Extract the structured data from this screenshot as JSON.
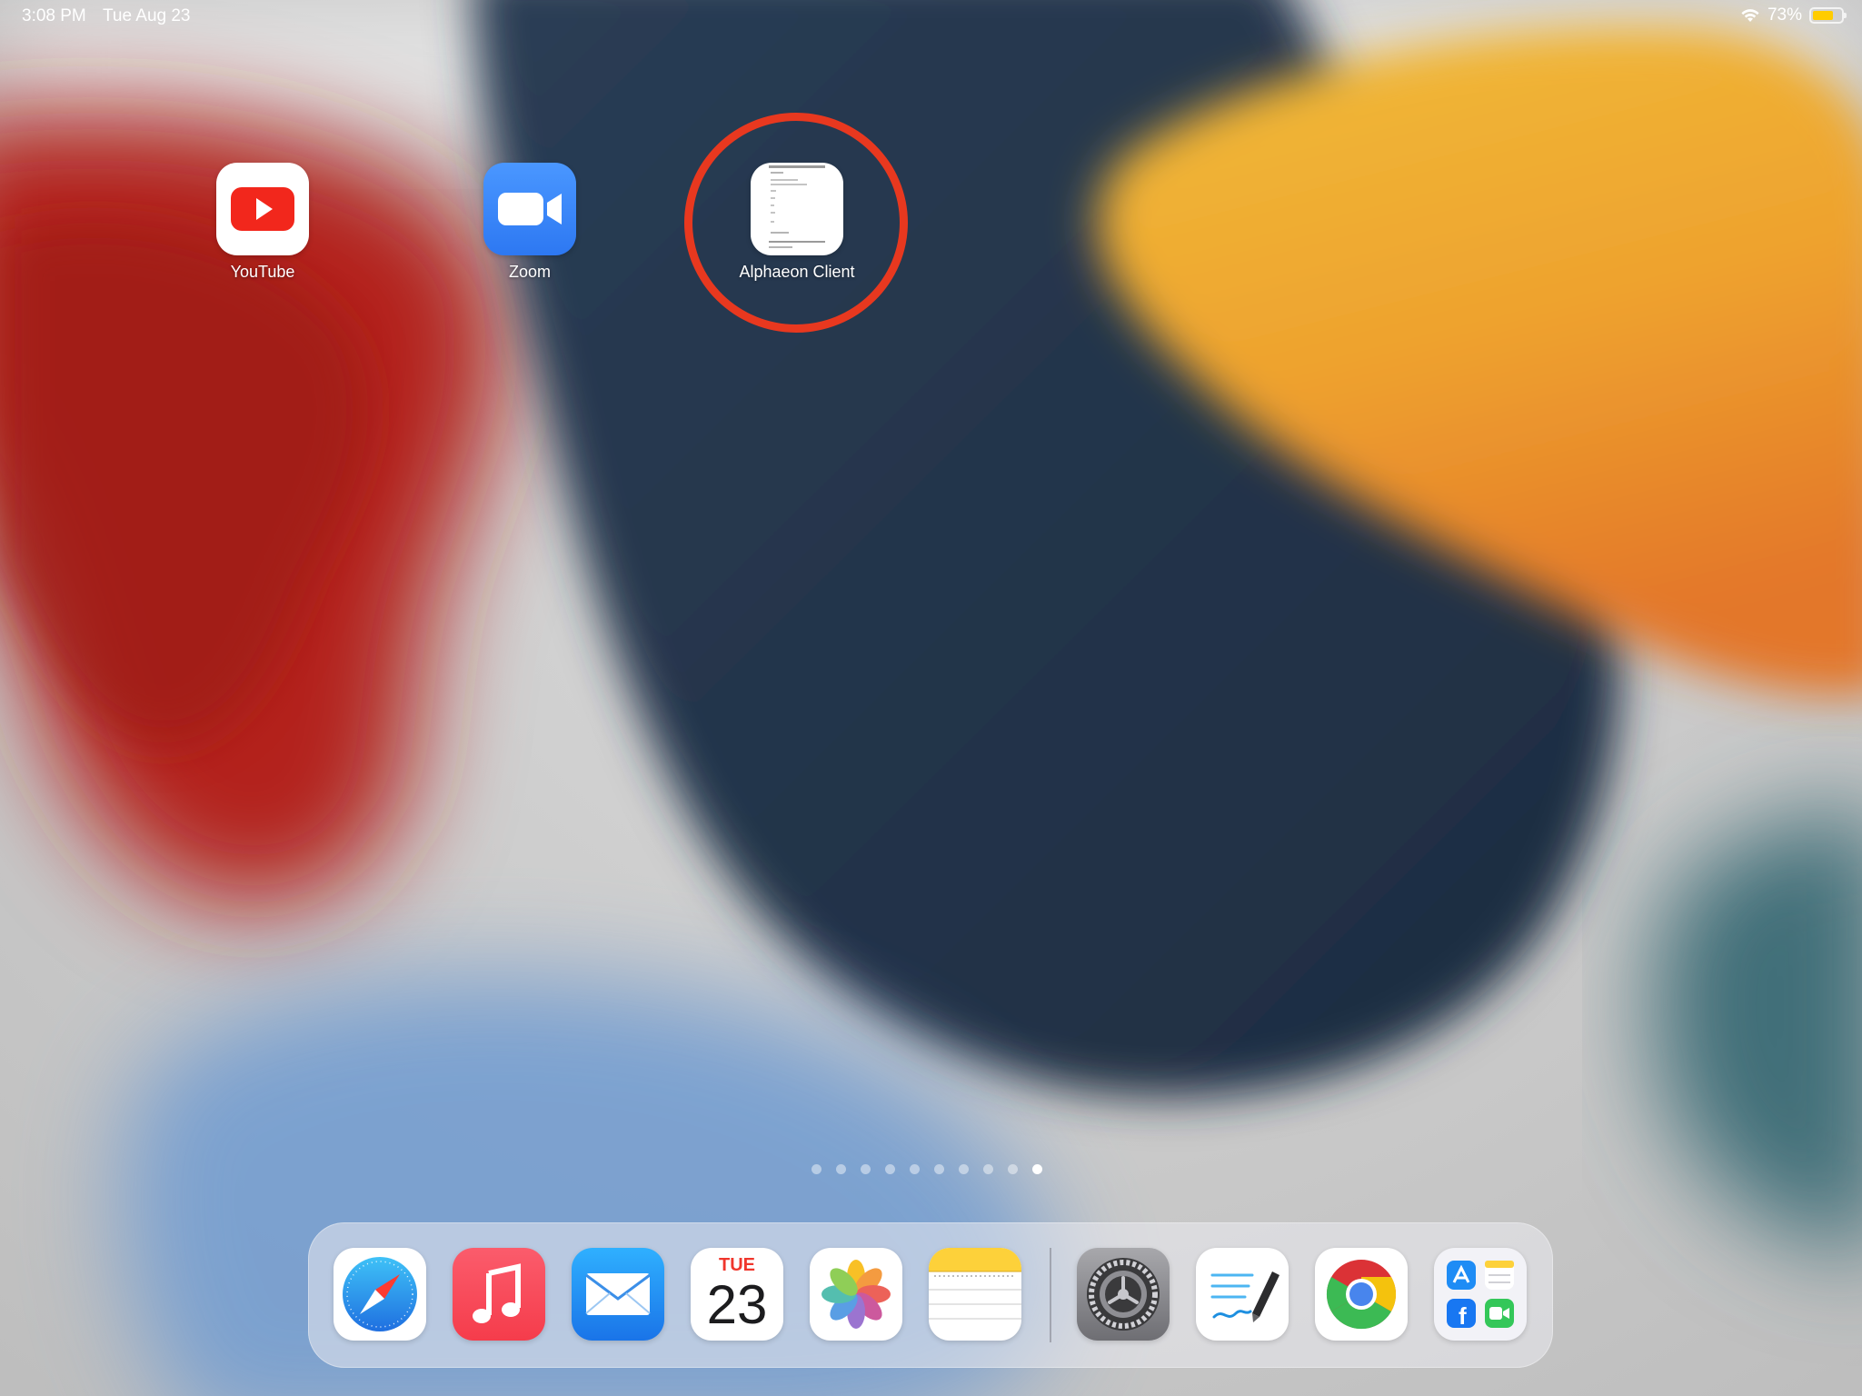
{
  "status_bar": {
    "time": "3:08 PM",
    "date": "Tue Aug 23",
    "battery_text": "73%",
    "battery_level": 0.73,
    "wifi_icon": "wifi-icon",
    "battery_icon": "battery-icon"
  },
  "home_apps": [
    {
      "label": "YouTube",
      "icon": "youtube-icon"
    },
    {
      "label": "Zoom",
      "icon": "zoom-icon"
    },
    {
      "label": "Alphaeon Client",
      "icon": "alphaeon-client-icon"
    }
  ],
  "page_indicator": {
    "count": 10,
    "active": 10
  },
  "dock": [
    {
      "icon": "safari-icon"
    },
    {
      "icon": "music-icon"
    },
    {
      "icon": "mail-icon"
    },
    {
      "icon": "calendar-icon",
      "day": "TUE",
      "date": "23"
    },
    {
      "icon": "photos-icon"
    },
    {
      "icon": "notes-icon"
    },
    {
      "icon": "settings-icon"
    },
    {
      "icon": "freeform-icon"
    },
    {
      "icon": "chrome-icon"
    },
    {
      "icon": "app-library-icon"
    }
  ],
  "colors": {
    "highlight_ring": "#e8381f",
    "youtube_red": "#ff0000",
    "zoom_blue": "#2d8cff"
  }
}
